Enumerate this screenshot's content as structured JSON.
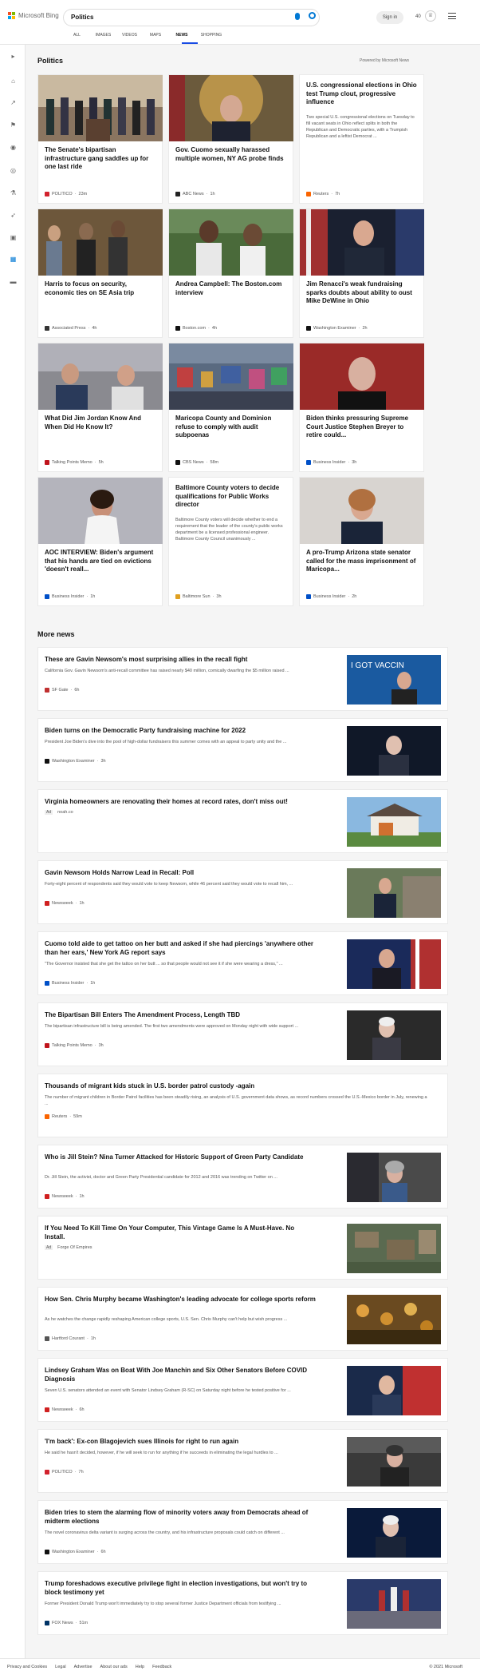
{
  "header": {
    "logo_text": "Microsoft Bing",
    "search_value": "Politics",
    "signin_label": "Sign in",
    "points": "40",
    "tabs": [
      "ALL",
      "IMAGES",
      "VIDEOS",
      "MAPS",
      "NEWS",
      "SHOPPING"
    ],
    "active_tab": "NEWS"
  },
  "section": {
    "title": "Politics",
    "powered": "Powered by Microsoft News"
  },
  "cards": [
    {
      "title": "The Senate's bipartisan infrastructure gang saddles up for one last ride",
      "source": "POLITICO",
      "time": "23m"
    },
    {
      "title": "Gov. Cuomo sexually harassed multiple women, NY AG probe finds",
      "source": "ABC News",
      "time": "1h"
    },
    {
      "title": "U.S. congressional elections in Ohio test Trump clout, progressive influence",
      "desc": "Two special U.S. congressional elections on Tuesday to fill vacant seats in Ohio reflect splits in both the Republican and Democratic parties, with a Trumpish Republican and a leftist Democrat ...",
      "source": "Reuters",
      "time": "7h"
    },
    {
      "title": "Harris to focus on security, economic ties on SE Asia trip",
      "source": "Associated Press",
      "time": "4h"
    },
    {
      "title": "Andrea Campbell: The Boston.com interview",
      "source": "Boston.com",
      "time": "4h"
    },
    {
      "title": "Jim Renacci's weak fundraising sparks doubts about ability to oust Mike DeWine in Ohio",
      "source": "Washington Examiner",
      "time": "2h"
    },
    {
      "title": "What Did Jim Jordan Know And When Did He Know It?",
      "source": "Talking Points Memo",
      "time": "5h"
    },
    {
      "title": "Maricopa County and Dominion refuse to comply with audit subpoenas",
      "source": "CBS News",
      "time": "58m"
    },
    {
      "title": "Biden thinks pressuring Supreme Court Justice Stephen Breyer to retire could...",
      "source": "Business Insider",
      "time": "3h"
    },
    {
      "title": "AOC INTERVIEW: Biden's argument that his hands are tied on evictions 'doesn't reall...",
      "source": "Business Insider",
      "time": "1h"
    },
    {
      "title": "Baltimore County voters to decide qualifications for Public Works director",
      "desc": "Baltimore County voters will decide whether to end a requirement that the leader of the county's public works department be a licensed professional engineer. Baltimore County Council unanimously ...",
      "source": "Baltimore Sun",
      "time": "3h"
    },
    {
      "title": "A pro-Trump Arizona state senator called for the mass imprisonment of Maricopa...",
      "source": "Business Insider",
      "time": "2h"
    }
  ],
  "more_news_title": "More news",
  "news": [
    {
      "title": "These are Gavin Newsom's most surprising allies in the recall fight",
      "desc": "California Gov. Gavin Newsom's anti-recall committee has raised nearly $40 million, comically dwarfing the $5 million raised ...",
      "source": "SF Gate",
      "time": "6h"
    },
    {
      "title": "Biden turns on the Democratic Party fundraising machine for 2022",
      "desc": "President Joe Biden's dive into the pool of high-dollar fundraisers this summer comes with an appeal to party unity and the ...",
      "source": "Washington Examiner",
      "time": "3h"
    },
    {
      "title": "Virginia homeowners are renovating their homes at record rates, don't miss out!",
      "desc": "",
      "source": "noah.co",
      "time": "",
      "ad": "Ad"
    },
    {
      "title": "Gavin Newsom Holds Narrow Lead in Recall: Poll",
      "desc": "Forty-eight percent of respondents said they would vote to keep Newsom, while 46 percent said they would vote to recall him, ...",
      "source": "Newsweek",
      "time": "1h"
    },
    {
      "title": "Cuomo told aide to get tattoo on her butt and asked if she had piercings 'anywhere other than her ears,' New York AG report says",
      "desc": "\"The Governor insisted that she get the tattoo on her butt ... so that people would not see it if she were wearing a dress,\" ...",
      "source": "Business Insider",
      "time": "1h"
    },
    {
      "title": "The Bipartisan Bill Enters The Amendment Process, Length TBD",
      "desc": "The bipartisan infrastructure bill is being amended. The first two amendments were approved on Monday night with wide support ...",
      "source": "Talking Points Memo",
      "time": "3h"
    },
    {
      "title": "Thousands of migrant kids stuck in U.S. border patrol custody -again",
      "desc": "The number of migrant children in Border Patrol facilities has been steadily rising, an analysis of U.S. government data shows, as record numbers crossed the U.S.-Mexico border in July, renewing a ...",
      "source": "Reuters",
      "time": "59m"
    },
    {
      "title": "Who is Jill Stein? Nina Turner Attacked for Historic Support of Green Party Candidate",
      "desc": "Dr. Jill Stein, the activist, doctor and Green Party Presidential candidate for 2012 and 2016 was trending on Twitter on ...",
      "source": "Newsweek",
      "time": "1h"
    },
    {
      "title": "If You Need To Kill Time On Your Computer, This Vintage Game Is A Must-Have. No Install.",
      "desc": "",
      "source": "Forge Of Empires",
      "time": "",
      "ad": "Ad"
    },
    {
      "title": "How Sen. Chris Murphy became Washington's leading advocate for college sports reform",
      "desc": "As he watches the change rapidly reshaping American college sports, U.S. Sen. Chris Murphy can't help but wish progress ...",
      "source": "Hartford Courant",
      "time": "1h"
    },
    {
      "title": "Lindsey Graham Was on Boat With Joe Manchin and Six Other Senators Before COVID Diagnosis",
      "desc": "Seven U.S. senators attended an event with Senator Lindsey Graham (R-SC) on Saturday night before he tested positive for ...",
      "source": "Newsweek",
      "time": "6h"
    },
    {
      "title": "'I'm back': Ex-con Blagojevich sues Illinois for right to run again",
      "desc": "He said he hasn't decided, however, if he will seek to run for anything if he succeeds in eliminating the legal hurdles to ...",
      "source": "POLITICO",
      "time": "7h"
    },
    {
      "title": "Biden tries to stem the alarming flow of minority voters away from Democrats ahead of midterm elections",
      "desc": "The novel coronavirus delta variant is surging across the country, and his infrastructure proposals could catch on different ...",
      "source": "Washington Examiner",
      "time": "6h"
    },
    {
      "title": "Trump foreshadows executive privilege fight in election investigations, but won't try to block testimony yet",
      "desc": "Former President Donald Trump won't immediately try to stop several former Justice Department officials from testifying ...",
      "source": "FOX News",
      "time": "51m"
    }
  ],
  "footer": {
    "links": [
      "Privacy and Cookies",
      "Legal",
      "Advertise",
      "About our ads",
      "Help",
      "Feedback"
    ],
    "copyright": "© 2021 Microsoft"
  }
}
